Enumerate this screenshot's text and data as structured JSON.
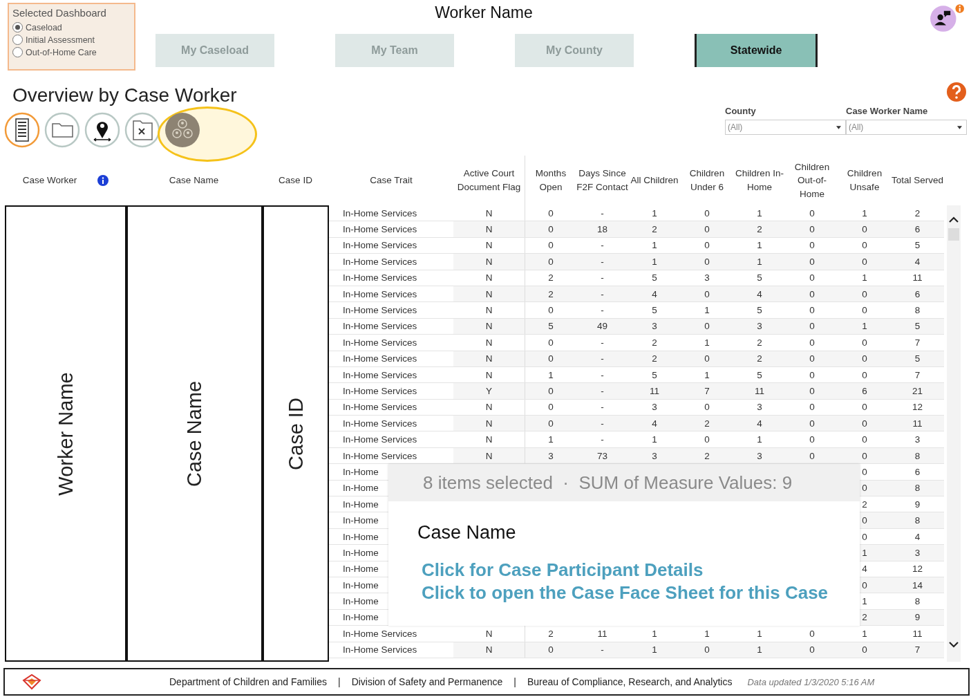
{
  "dashboard_selector": {
    "title": "Selected Dashboard",
    "options": [
      {
        "label": "Caseload",
        "selected": true
      },
      {
        "label": "Initial Assessment",
        "selected": false
      },
      {
        "label": "Out-of-Home Care",
        "selected": false
      }
    ]
  },
  "worker_name": "Worker Name",
  "scope_buttons": [
    {
      "label": "My Caseload",
      "selected": false
    },
    {
      "label": "My Team",
      "selected": false
    },
    {
      "label": "My County",
      "selected": false
    },
    {
      "label": "Statewide",
      "selected": true
    }
  ],
  "page_title": "Overview by Case Worker",
  "view_icons": [
    {
      "kind": "list",
      "selected": true,
      "highlighted": false
    },
    {
      "kind": "folder",
      "selected": false,
      "highlighted": false
    },
    {
      "kind": "pin",
      "selected": false,
      "highlighted": false
    },
    {
      "kind": "folder-x",
      "selected": false,
      "highlighted": false
    },
    {
      "kind": "people",
      "selected": false,
      "highlighted": true
    }
  ],
  "filters": [
    {
      "label": "County",
      "value": "(All)"
    },
    {
      "label": "Case Worker Name",
      "value": "(All)"
    }
  ],
  "table": {
    "left_columns": [
      {
        "header": "Case Worker",
        "info": true,
        "value": "Worker Name"
      },
      {
        "header": "Case Name",
        "info": false,
        "value": "Case Name"
      },
      {
        "header": "Case ID",
        "info": false,
        "value": "Case ID"
      }
    ],
    "columns": [
      "Case Trait",
      "Active Court Document Flag",
      "Months Open",
      "Days Since F2F Contact",
      "All Children",
      "Children Under 6",
      "Children In-Home",
      "Children Out-of-Home",
      "Children Unsafe",
      "Total Served"
    ],
    "rows": [
      {
        "kind": "full",
        "cells": [
          "In-Home Services",
          "N",
          "0",
          "-",
          "1",
          "0",
          "1",
          "0",
          "1",
          "2"
        ]
      },
      {
        "kind": "full",
        "cells": [
          "In-Home Services",
          "N",
          "0",
          "18",
          "2",
          "0",
          "2",
          "0",
          "0",
          "6"
        ]
      },
      {
        "kind": "full",
        "cells": [
          "In-Home Services",
          "N",
          "0",
          "-",
          "1",
          "0",
          "1",
          "0",
          "0",
          "5"
        ]
      },
      {
        "kind": "full",
        "cells": [
          "In-Home Services",
          "N",
          "0",
          "-",
          "1",
          "0",
          "1",
          "0",
          "0",
          "4"
        ]
      },
      {
        "kind": "full",
        "cells": [
          "In-Home Services",
          "N",
          "2",
          "-",
          "5",
          "3",
          "5",
          "0",
          "1",
          "11"
        ]
      },
      {
        "kind": "full",
        "cells": [
          "In-Home Services",
          "N",
          "2",
          "-",
          "4",
          "0",
          "4",
          "0",
          "0",
          "6"
        ]
      },
      {
        "kind": "full",
        "cells": [
          "In-Home Services",
          "N",
          "0",
          "-",
          "5",
          "1",
          "5",
          "0",
          "0",
          "8"
        ]
      },
      {
        "kind": "full",
        "cells": [
          "In-Home Services",
          "N",
          "5",
          "49",
          "3",
          "0",
          "3",
          "0",
          "1",
          "5"
        ]
      },
      {
        "kind": "full",
        "cells": [
          "In-Home Services",
          "N",
          "0",
          "-",
          "2",
          "1",
          "2",
          "0",
          "0",
          "7"
        ]
      },
      {
        "kind": "full",
        "cells": [
          "In-Home Services",
          "N",
          "0",
          "-",
          "2",
          "0",
          "2",
          "0",
          "0",
          "5"
        ]
      },
      {
        "kind": "full",
        "cells": [
          "In-Home Services",
          "N",
          "1",
          "-",
          "5",
          "1",
          "5",
          "0",
          "0",
          "7"
        ]
      },
      {
        "kind": "full",
        "cells": [
          "In-Home Services",
          "Y",
          "0",
          "-",
          "11",
          "7",
          "11",
          "0",
          "6",
          "21"
        ]
      },
      {
        "kind": "full",
        "cells": [
          "In-Home Services",
          "N",
          "0",
          "-",
          "3",
          "0",
          "3",
          "0",
          "0",
          "12"
        ]
      },
      {
        "kind": "full",
        "cells": [
          "In-Home Services",
          "N",
          "0",
          "-",
          "4",
          "2",
          "4",
          "0",
          "0",
          "11"
        ]
      },
      {
        "kind": "full",
        "cells": [
          "In-Home Services",
          "N",
          "1",
          "-",
          "1",
          "0",
          "1",
          "0",
          "0",
          "3"
        ]
      },
      {
        "kind": "full",
        "cells": [
          "In-Home Services",
          "N",
          "3",
          "73",
          "3",
          "2",
          "3",
          "0",
          "0",
          "8"
        ]
      },
      {
        "kind": "covered",
        "trait": "In-Home",
        "unsafe": "0",
        "total": "6"
      },
      {
        "kind": "covered",
        "trait": "In-Home",
        "unsafe": "0",
        "total": "8"
      },
      {
        "kind": "covered",
        "trait": "In-Home",
        "unsafe": "2",
        "total": "9"
      },
      {
        "kind": "covered",
        "trait": "In-Home",
        "unsafe": "0",
        "total": "8"
      },
      {
        "kind": "covered",
        "trait": "In-Home",
        "unsafe": "0",
        "total": "4"
      },
      {
        "kind": "covered",
        "trait": "In-Home",
        "unsafe": "1",
        "total": "3"
      },
      {
        "kind": "covered",
        "trait": "In-Home",
        "unsafe": "4",
        "total": "12"
      },
      {
        "kind": "covered",
        "trait": "In-Home",
        "unsafe": "0",
        "total": "14"
      },
      {
        "kind": "covered",
        "trait": "In-Home",
        "unsafe": "1",
        "total": "8"
      },
      {
        "kind": "covered",
        "trait": "In-Home",
        "unsafe": "2",
        "total": "9"
      },
      {
        "kind": "full",
        "cells": [
          "In-Home Services",
          "N",
          "2",
          "11",
          "1",
          "1",
          "1",
          "0",
          "1",
          "11"
        ]
      },
      {
        "kind": "full",
        "cells": [
          "In-Home Services",
          "N",
          "0",
          "-",
          "1",
          "0",
          "1",
          "0",
          "0",
          "7"
        ]
      }
    ]
  },
  "tooltip": {
    "summary": "8 items selected  ·  SUM of Measure Values: 9",
    "heading": "Case Name",
    "links": [
      "Click for Case Participant Details",
      "Click to open the Case Face Sheet for this Case"
    ]
  },
  "footer": {
    "items": [
      "Department of Children and Families",
      "Division of Safety and Permanence",
      "Bureau of Compliance, Research, and Analytics"
    ],
    "separator": "|",
    "updated": "Data updated 1/3/2020 5:16 AM"
  }
}
